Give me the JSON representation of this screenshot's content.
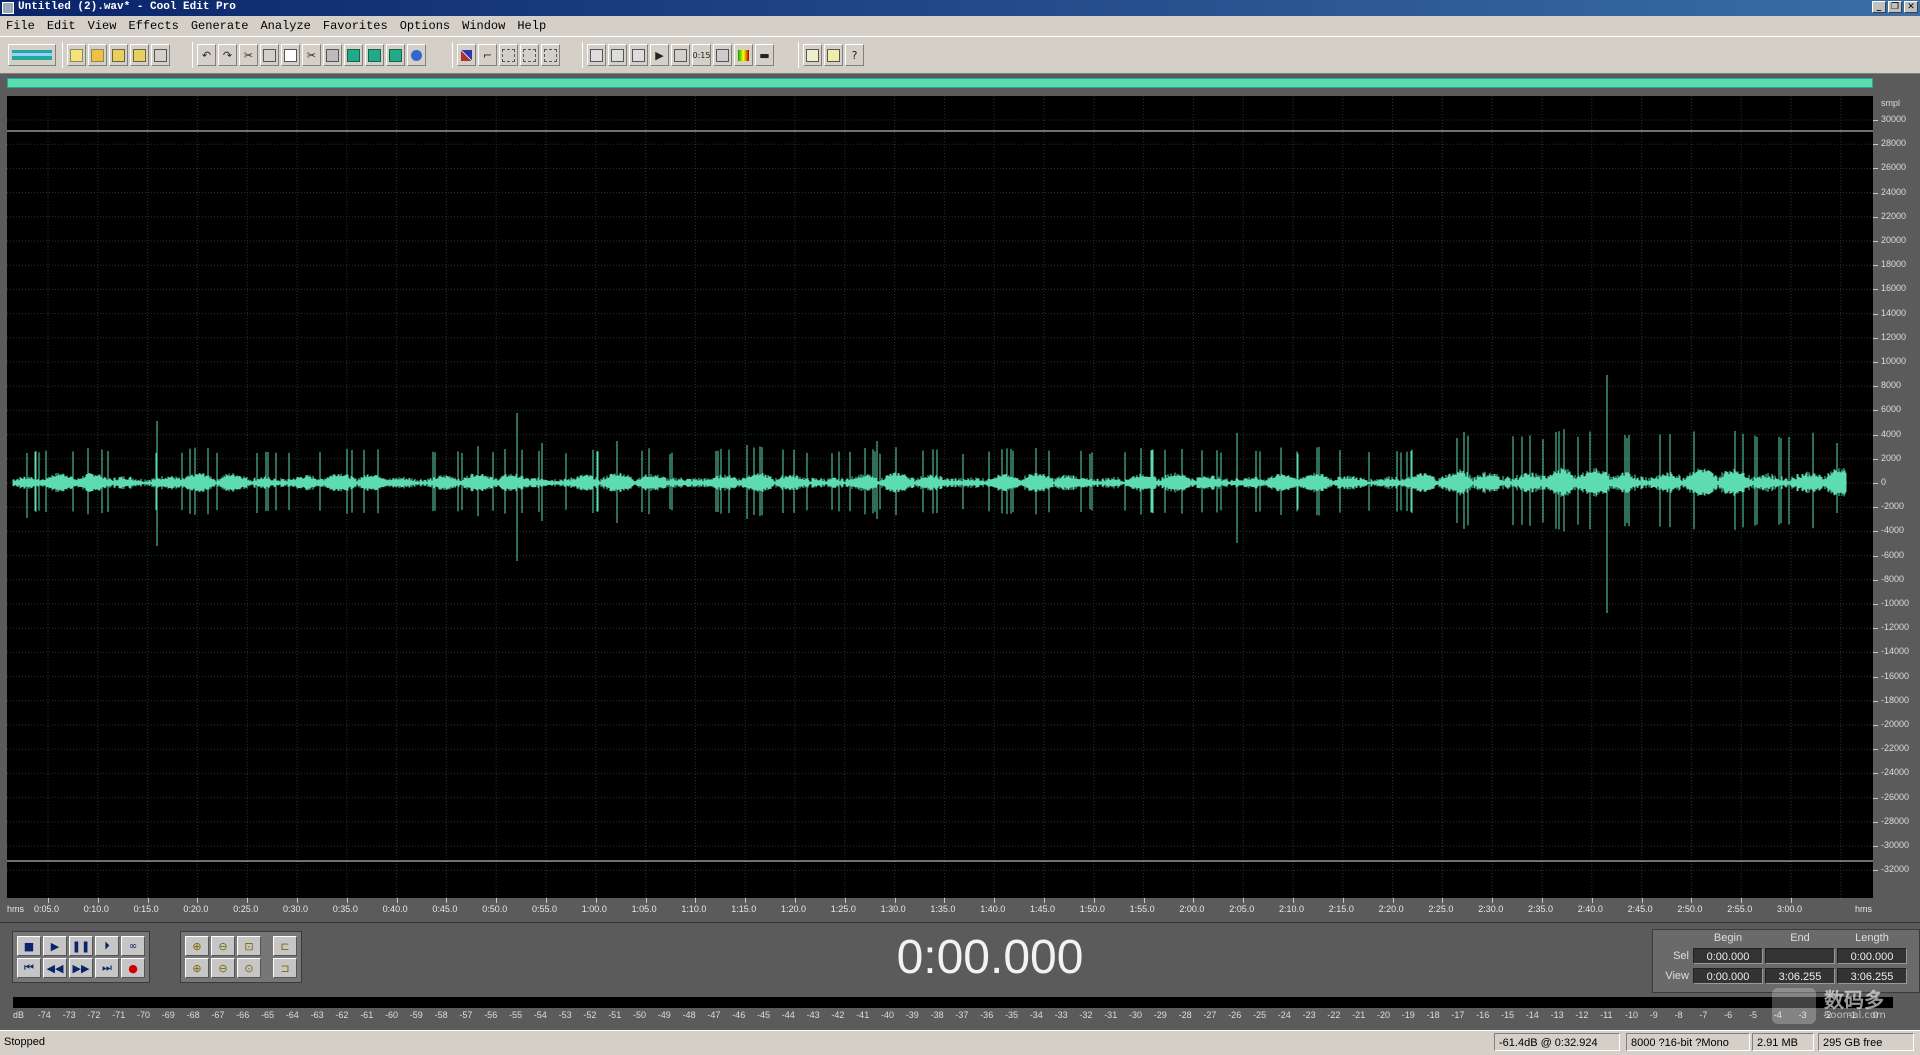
{
  "window": {
    "title": "Untitled (2).wav* - Cool Edit Pro",
    "minimize": "_",
    "restore": "❐",
    "close": "✕"
  },
  "menu": [
    "File",
    "Edit",
    "View",
    "Effects",
    "Generate",
    "Analyze",
    "Favorites",
    "Options",
    "Window",
    "Help"
  ],
  "colors": {
    "waveform": "#5ddcb0",
    "background": "#000000",
    "grid": "#1f3a2a",
    "panel": "#5b5b5b",
    "clip_line": "#e0e0e0"
  },
  "toolbar": {
    "icons": [
      "mode-toggle-icon",
      "new-file-icon",
      "open-file-icon",
      "save-icon",
      "save-as-icon",
      "close-file-icon",
      "undo-icon",
      "redo-icon",
      "cut-icon",
      "select-all-icon",
      "copy-icon",
      "scissors-icon",
      "paste-icon",
      "paste-new-icon",
      "mix-paste-icon",
      "cd-extract-icon",
      "envelope-icon",
      "zero-crossing-icon",
      "snap-icon",
      "grid-icon",
      "spectral-icon",
      "waveform-view-icon",
      "marker-icon",
      "loop-icon",
      "play-icon",
      "zoom-view-icon",
      "time-format-icon",
      "bars-icon",
      "meter-icon",
      "horizontal-line-icon",
      "settings-icon",
      "cd-player-icon",
      "help-icon"
    ]
  },
  "y_axis": {
    "unit": "smpl",
    "labels": [
      "30000",
      "28000",
      "26000",
      "24000",
      "22000",
      "20000",
      "18000",
      "16000",
      "14000",
      "12000",
      "10000",
      "8000",
      "6000",
      "4000",
      "2000",
      "0",
      "-2000",
      "-4000",
      "-6000",
      "-8000",
      "-10000",
      "-12000",
      "-14000",
      "-16000",
      "-18000",
      "-20000",
      "-22000",
      "-24000",
      "-26000",
      "-28000",
      "-30000",
      "-32000"
    ]
  },
  "x_axis": {
    "unit_left": "hms",
    "unit_right": "hms",
    "labels": [
      "0:05.0",
      "0:10.0",
      "0:15.0",
      "0:20.0",
      "0:25.0",
      "0:30.0",
      "0:35.0",
      "0:40.0",
      "0:45.0",
      "0:50.0",
      "0:55.0",
      "1:00.0",
      "1:05.0",
      "1:10.0",
      "1:15.0",
      "1:20.0",
      "1:25.0",
      "1:30.0",
      "1:35.0",
      "1:40.0",
      "1:45.0",
      "1:50.0",
      "1:55.0",
      "2:00.0",
      "2:05.0",
      "2:10.0",
      "2:15.0",
      "2:20.0",
      "2:25.0",
      "2:30.0",
      "2:35.0",
      "2:40.0",
      "2:45.0",
      "2:50.0",
      "2:55.0",
      "3:00.0"
    ]
  },
  "transport": {
    "time": "0:00.000",
    "buttons": [
      "stop",
      "play",
      "pause",
      "play-to-end",
      "loop",
      "go-to-start",
      "rewind",
      "fast-forward",
      "go-to-end",
      "record"
    ],
    "zoom_buttons": [
      "zoom-in-horizontal",
      "zoom-out-horizontal",
      "zoom-full",
      "zoom-in-left",
      "zoom-in-vertical",
      "zoom-out-vertical",
      "zoom-fit",
      "zoom-in-right"
    ]
  },
  "selection": {
    "header_begin": "Begin",
    "header_end": "End",
    "header_length": "Length",
    "sel_label": "Sel",
    "view_label": "View",
    "sel_begin": "0:00.000",
    "sel_end": "",
    "sel_length": "0:00.000",
    "view_begin": "0:00.000",
    "view_end": "3:06.255",
    "view_length": "3:06.255"
  },
  "meter": {
    "labels": [
      "dB",
      "-74",
      "-73",
      "-72",
      "-71",
      "-70",
      "-69",
      "-68",
      "-67",
      "-66",
      "-65",
      "-64",
      "-63",
      "-62",
      "-61",
      "-60",
      "-59",
      "-58",
      "-57",
      "-56",
      "-55",
      "-54",
      "-53",
      "-52",
      "-51",
      "-50",
      "-49",
      "-48",
      "-47",
      "-46",
      "-45",
      "-44",
      "-43",
      "-42",
      "-41",
      "-40",
      "-39",
      "-38",
      "-37",
      "-36",
      "-35",
      "-34",
      "-33",
      "-32",
      "-31",
      "-30",
      "-29",
      "-28",
      "-27",
      "-26",
      "-25",
      "-24",
      "-23",
      "-22",
      "-21",
      "-20",
      "-19",
      "-18",
      "-17",
      "-16",
      "-15",
      "-14",
      "-13",
      "-12",
      "-11",
      "-10",
      "-9",
      "-8",
      "-7",
      "-6",
      "-5",
      "-4",
      "-3",
      "-2",
      "-1",
      "0"
    ]
  },
  "status": {
    "state": "Stopped",
    "cursor": "-61.4dB @   0:32.924",
    "format": "8000 ?16-bit ?Mono",
    "size": "2.91 MB",
    "free": "295 GB free"
  },
  "watermark": {
    "text": "数码多",
    "sub": "Soomal.com"
  }
}
